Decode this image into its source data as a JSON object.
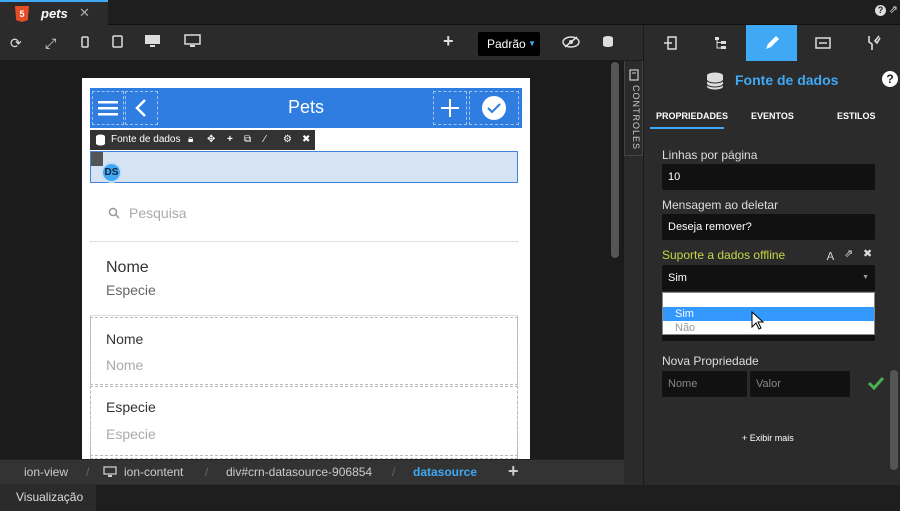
{
  "tab": {
    "badge": "5",
    "name": "pets",
    "close": "✕"
  },
  "toolbar": {
    "device_select": "Padrão",
    "add": "+"
  },
  "side_label": "CONTROLES",
  "phone": {
    "title": "Pets",
    "datasource_bar_label": "Fonte de dados",
    "ds_badge": "DS",
    "search_placeholder": "Pesquisa",
    "item_title": "Nome",
    "item_subtitle": "Especie",
    "field1_label": "Nome",
    "field1_placeholder": "Nome",
    "field2_label": "Especie",
    "field2_placeholder": "Especie"
  },
  "panel": {
    "title": "Fonte de dados",
    "help": "?",
    "subtabs": [
      "PROPRIEDADES",
      "EVENTOS",
      "ESTILOS"
    ],
    "rows_label": "Linhas por página",
    "rows_value": "10",
    "delete_msg_label": "Mensagem ao deletar",
    "delete_msg_value": "Deseja remover?",
    "offline_label": "Suporte a dados offline",
    "offline_value": "Sim",
    "offline_options": [
      "Sim",
      "Não"
    ],
    "new_prop_label": "Nova Propriedade",
    "name_placeholder": "Nome",
    "value_placeholder": "Valor",
    "show_more": "+ Exibir mais"
  },
  "breadcrumb": [
    "ion-view",
    "ion-content",
    "div#crn-datasource-906854",
    "datasource"
  ],
  "status": {
    "view_label": "Visualização"
  },
  "colors": {
    "accent": "#3fa9f5",
    "header": "#2f7de1",
    "offline_label": "#c8d647",
    "check": "#4caf50"
  }
}
